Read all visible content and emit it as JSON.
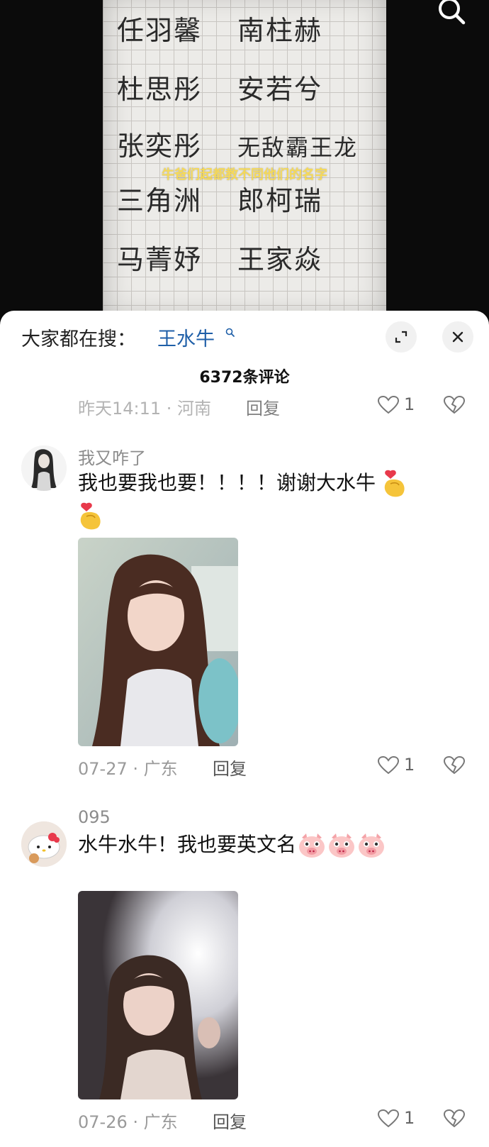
{
  "video": {
    "paper_rows": [
      [
        "任羽馨",
        "南柱赫"
      ],
      [
        "杜思彤",
        "安若兮"
      ],
      [
        "张奕彤",
        "无敌霸王龙"
      ],
      [
        "三角洲",
        "郎柯瑞"
      ],
      [
        "马菁妤",
        "王家焱"
      ]
    ],
    "caption": "牛爸们起都教不同他们的名字"
  },
  "header": {
    "hot_label": "大家都在搜：",
    "hot_term": "王水牛",
    "comment_count": "6372条评论"
  },
  "partial_comment": {
    "meta": "昨天14:11 · 河南",
    "reply": "回复",
    "likes": "1"
  },
  "comments": [
    {
      "user": "我又咋了",
      "text": "我也要我也要！！！！谢谢大水牛",
      "meta": "07-27 · 广东",
      "reply": "回复",
      "likes": "1"
    },
    {
      "user": "095",
      "text": "水牛水牛！我也要英文名",
      "meta": "07-26 · 广东",
      "reply": "回复",
      "likes": "1"
    }
  ],
  "colors": {
    "accent_link": "#1f5fa8",
    "caption_yellow": "#f6d84a",
    "muted": "#9a9a9a"
  }
}
